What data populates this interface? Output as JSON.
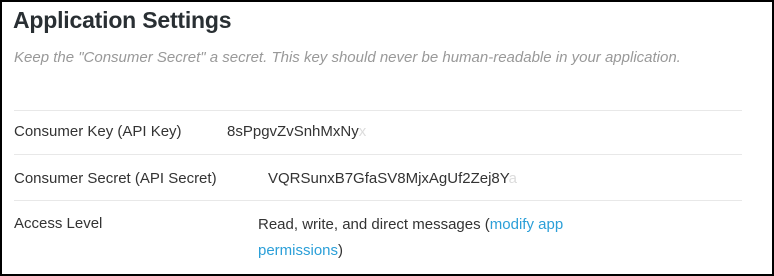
{
  "settings": {
    "title": "Application Settings",
    "note": "Keep the \"Consumer Secret\" a secret. This key should never be human-readable in your application.",
    "consumer_key": {
      "label": "Consumer Key (API Key)",
      "value_visible": "8sPpgvZvSnhMxNy",
      "value_faded": "x"
    },
    "consumer_secret": {
      "label": "Consumer Secret (API Secret)",
      "value_visible": "VQRSunxB7GfaSV8MjxAgUf2Zej8Y",
      "value_faded": "a"
    },
    "access_level": {
      "label": "Access Level",
      "value_text": "Read, write, and direct messages (",
      "link_text": "modify app permissions",
      "value_suffix": ")"
    }
  },
  "colors": {
    "link": "#2b9fd8",
    "note": "#999999",
    "text": "#333333"
  }
}
